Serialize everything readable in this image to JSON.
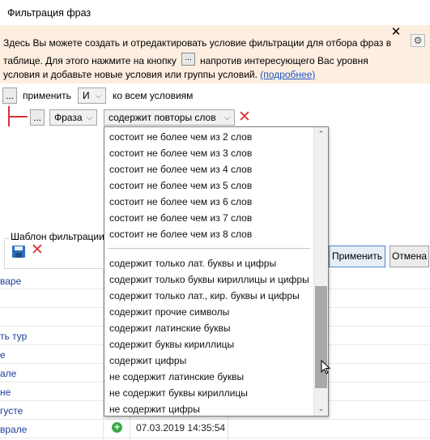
{
  "window": {
    "title": "Фильтрация фраз"
  },
  "info": {
    "line1": "Здесь Вы можете создать и отредактировать условие фильтрации для отбора фраз в",
    "line2a": "таблице. Для этого нажмите на кнопку",
    "line2_btn": "...",
    "line2b": "напротив интересующего Вас уровня",
    "line3": "условия и добавьте новые условия или группы условий.",
    "link": "(подробнее)",
    "close_glyph": "✕",
    "gear_glyph": "⚙"
  },
  "filter_row": {
    "menu_btn": "...",
    "apply_label": "применить",
    "operator": "И",
    "tail_label": "ко всем условиям"
  },
  "condition": {
    "menu_btn": "...",
    "field": "Фраза",
    "operator": "содержит повторы слов"
  },
  "dropdown": {
    "items_top": [
      "состоит не более чем из 2 слов",
      "состоит не более чем из 3 слов",
      "состоит не более чем из 4 слов",
      "состоит не более чем из 5 слов",
      "состоит не более чем из 6 слов",
      "состоит не более чем из 7 слов",
      "состоит не более чем из 8 слов"
    ],
    "items_bottom": [
      "содержит только лат. буквы и цифры",
      "содержит только буквы кириллицы и цифры",
      "содержит только лат., кир. буквы и цифры",
      "содержит прочие символы",
      "содержит латинские буквы",
      "содержит буквы кириллицы",
      "содержит цифры",
      "не содержит латинские буквы",
      "не содержит буквы кириллицы",
      "не содержит цифры"
    ]
  },
  "template": {
    "label": "Шаблон фильтрации"
  },
  "buttons": {
    "apply": "Применить",
    "cancel": "Отмена"
  },
  "grid": {
    "left_cells": [
      "варе",
      "ть тур",
      "е",
      "але",
      "не",
      "густе",
      "врале"
    ],
    "last_row_date": "07.03.2019 14:35:54"
  },
  "colors": {
    "info_bg": "#fdeee0",
    "accent_red": "#d9323a",
    "link": "#1a56c8"
  }
}
